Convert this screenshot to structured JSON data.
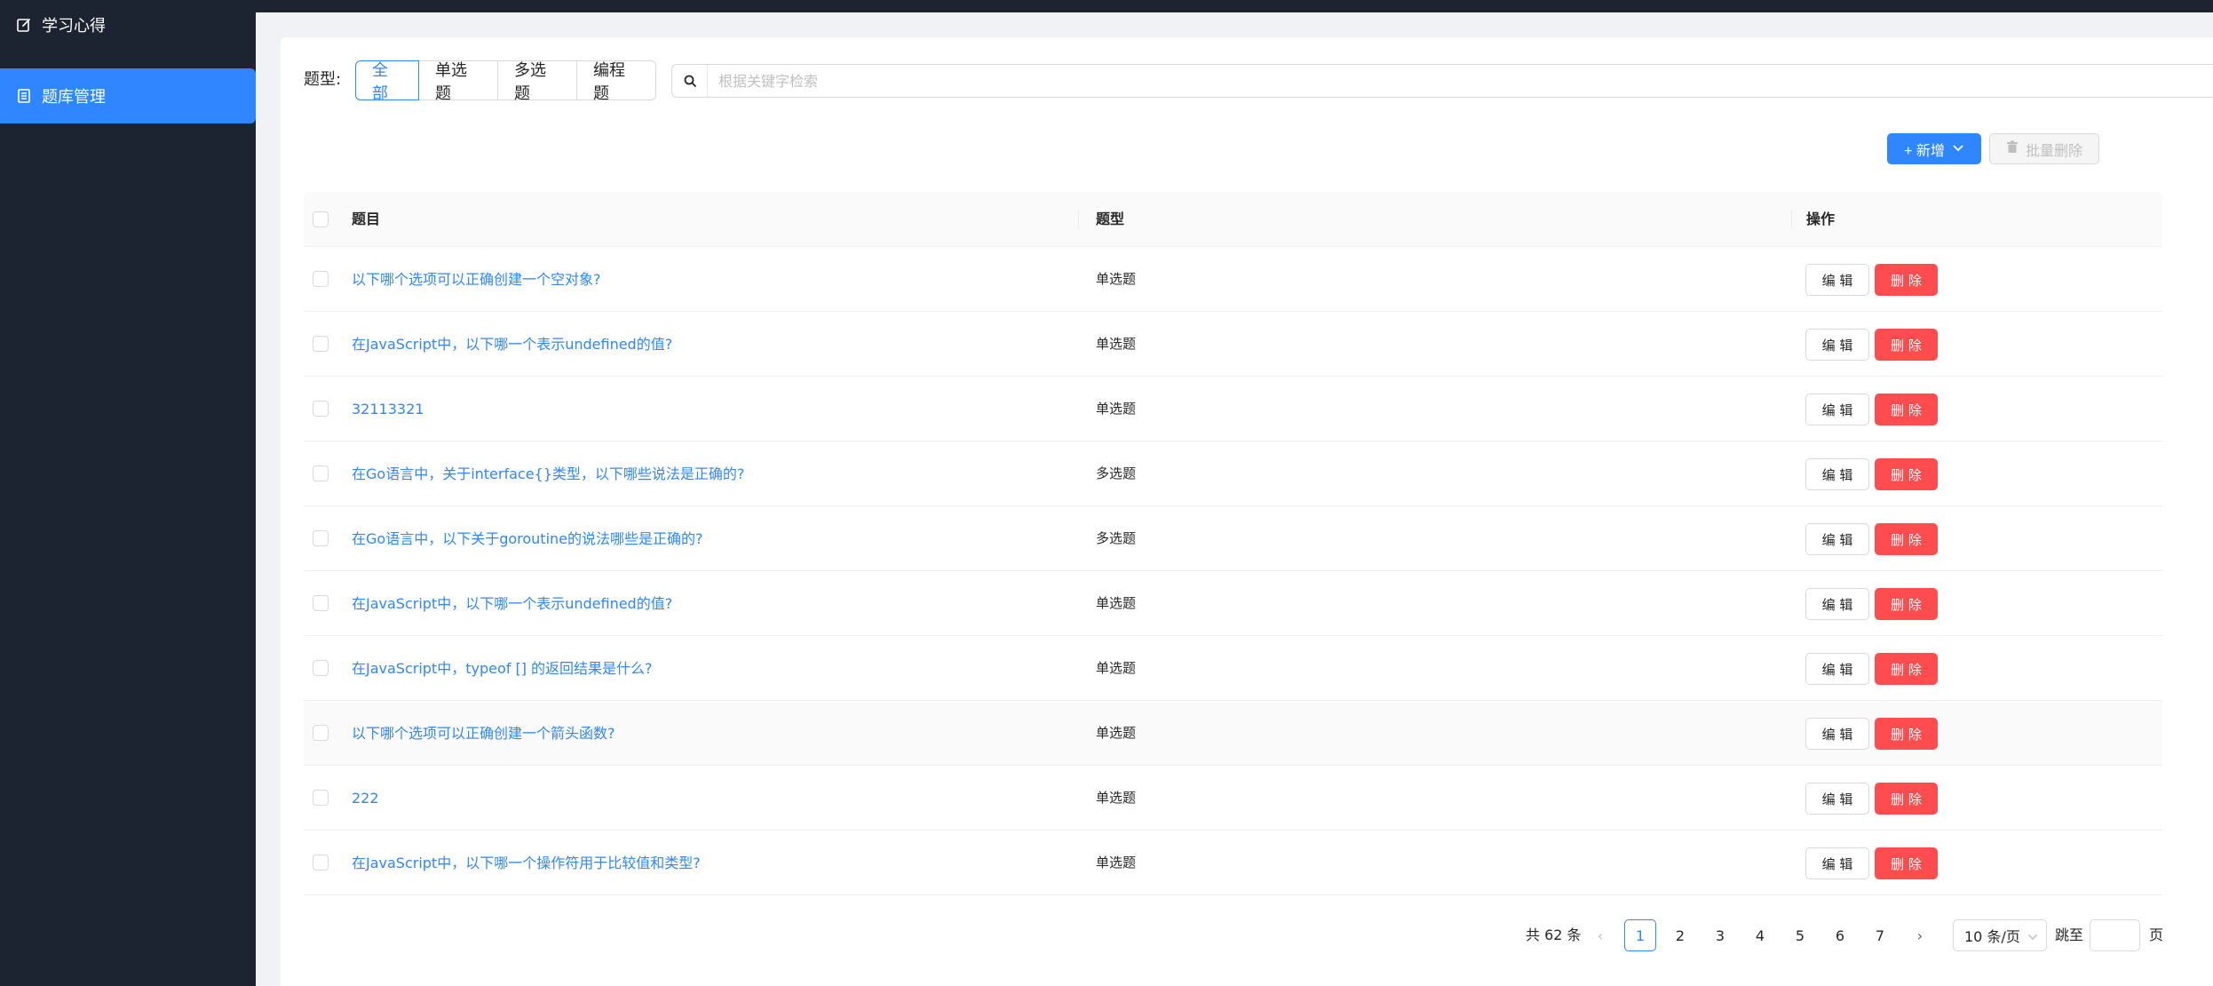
{
  "sidebar": {
    "items": [
      {
        "label": "学习心得",
        "icon": "edit-icon"
      },
      {
        "label": "题库管理",
        "icon": "list-icon"
      }
    ]
  },
  "filter": {
    "label": "题型:",
    "options": [
      "全部",
      "单选题",
      "多选题",
      "编程题"
    ],
    "active": "全部"
  },
  "search": {
    "placeholder": "根据关键字检索",
    "value": ""
  },
  "actions": {
    "new_label": "+ 新增",
    "batch_delete_label": "批量删除"
  },
  "table": {
    "headers": [
      "题目",
      "题型",
      "操作"
    ],
    "rows": [
      {
        "question": "以下哪个选项可以正确创建一个空对象?",
        "type": "单选题"
      },
      {
        "question": "在JavaScript中，以下哪一个表示undefined的值?",
        "type": "单选题"
      },
      {
        "question": "32113321",
        "type": "单选题"
      },
      {
        "question": "在Go语言中，关于interface{}类型，以下哪些说法是正确的?",
        "type": "多选题"
      },
      {
        "question": "在Go语言中，以下关于goroutine的说法哪些是正确的?",
        "type": "多选题"
      },
      {
        "question": "在JavaScript中，以下哪一个表示undefined的值?",
        "type": "单选题"
      },
      {
        "question": "在JavaScript中，typeof [] 的返回结果是什么?",
        "type": "单选题"
      },
      {
        "question": "以下哪个选项可以正确创建一个箭头函数?",
        "type": "单选题"
      },
      {
        "question": "222",
        "type": "单选题"
      },
      {
        "question": "在JavaScript中，以下哪一个操作符用于比较值和类型?",
        "type": "单选题"
      }
    ],
    "edit_label": "编 辑",
    "delete_label": "删 除"
  },
  "pagination": {
    "total_label": "共 62 条",
    "pages": [
      "1",
      "2",
      "3",
      "4",
      "5",
      "6",
      "7"
    ],
    "current": "1",
    "page_size_label": "10 条/页",
    "jump_label": "跳至",
    "page_suffix": "页",
    "prev_symbol": "‹",
    "next_symbol": "›"
  },
  "colors": {
    "sidebar_bg": "#1c2431",
    "primary": "#2f86ff",
    "danger": "#ff4d4f"
  }
}
